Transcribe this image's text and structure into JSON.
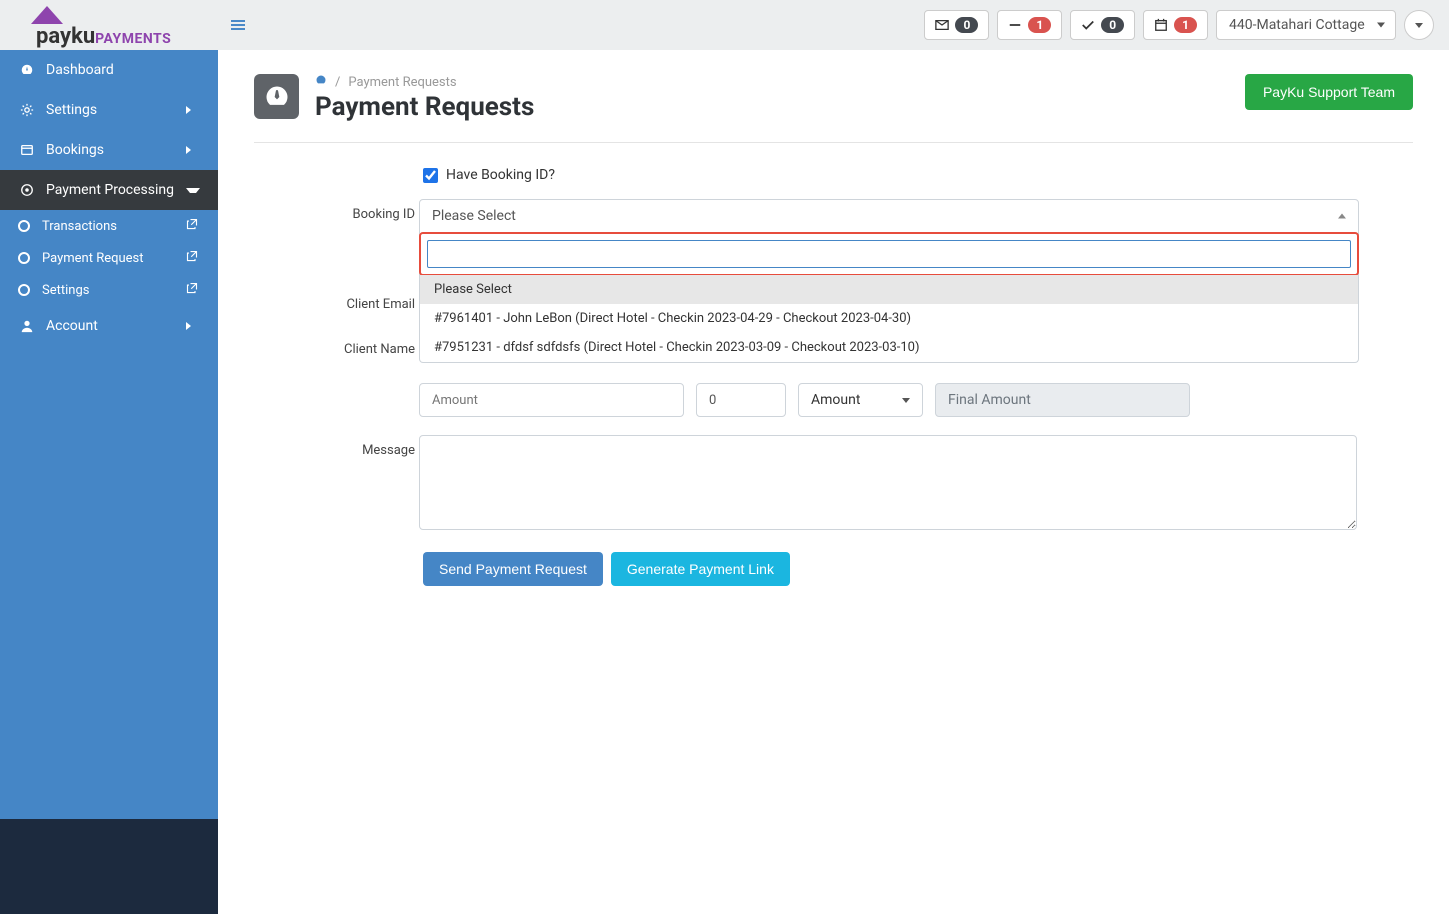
{
  "logo": {
    "main": "payku",
    "sub": "PAYMENTS"
  },
  "topbar": {
    "badges": [
      {
        "icon": "envelope",
        "count": "0",
        "red": false
      },
      {
        "icon": "minus",
        "count": "1",
        "red": true
      },
      {
        "icon": "check",
        "count": "0",
        "red": false
      },
      {
        "icon": "calendar",
        "count": "1",
        "red": true
      }
    ],
    "property": "440-Matahari Cottage"
  },
  "sidebar": {
    "items": [
      {
        "icon": "dashboard",
        "label": "Dashboard",
        "expandable": false
      },
      {
        "icon": "gear",
        "label": "Settings",
        "expandable": true
      },
      {
        "icon": "address",
        "label": "Bookings",
        "expandable": true
      }
    ],
    "payment_processing": "Payment Processing",
    "sub": [
      {
        "label": "Transactions",
        "active": false
      },
      {
        "label": "Payment Request",
        "active": true
      },
      {
        "label": "Settings",
        "active": false
      }
    ],
    "account": {
      "label": "Account"
    }
  },
  "page": {
    "breadcrumb_current": "Payment Requests",
    "title": "Payment Requests",
    "support_btn": "PayKu Support Team"
  },
  "form": {
    "have_booking_label": "Have Booking ID?",
    "have_booking_checked": true,
    "booking_id_label": "Booking ID",
    "booking_id_placeholder": "Please Select",
    "dropdown": {
      "options": [
        "Please Select",
        "#7961401 - John LeBon (Direct Hotel - Checkin 2023-04-29 - Checkout 2023-04-30)",
        "#7951231 - dfdsf sdfdsfs (Direct Hotel - Checkin 2023-03-09 - Checkout 2023-03-10)"
      ]
    },
    "client_email_label": "Client Email",
    "client_name_label": "Client Name",
    "amount_placeholder": "Amount",
    "discount_value": "0",
    "amount_type_label": "Amount",
    "final_amount_placeholder": "Final Amount",
    "message_label": "Message",
    "send_btn": "Send Payment Request",
    "generate_btn": "Generate Payment Link"
  }
}
